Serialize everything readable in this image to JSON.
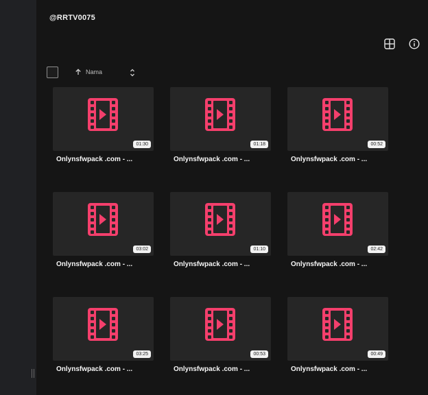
{
  "header": {
    "title": "@RRTV0075"
  },
  "toolbar": {
    "sort_label": "Nama"
  },
  "icons": {
    "grid_view": "grid-view-icon",
    "info": "info-icon",
    "sort_up": "arrow-up-icon",
    "sort_toggle": "chevron-up-down-icon",
    "video_file": "video-file-icon",
    "sidebar_handle": "resize-handle-icon"
  },
  "colors": {
    "video_icon": "#f43f6c",
    "background": "#151515",
    "sidebar": "#202124",
    "thumb": "#262626"
  },
  "files": [
    {
      "name": "Onlynsfwpack .com - ...",
      "duration": "01:30"
    },
    {
      "name": "Onlynsfwpack .com - ...",
      "duration": "01:18"
    },
    {
      "name": "Onlynsfwpack .com - ...",
      "duration": "00:52"
    },
    {
      "name": "Onlynsfwpack .com - ...",
      "duration": "03:02"
    },
    {
      "name": "Onlynsfwpack .com - ...",
      "duration": "01:10"
    },
    {
      "name": "Onlynsfwpack .com - ...",
      "duration": "02:42"
    },
    {
      "name": "Onlynsfwpack .com - ...",
      "duration": "03:25"
    },
    {
      "name": "Onlynsfwpack .com - ...",
      "duration": "00:53"
    },
    {
      "name": "Onlynsfwpack .com - ...",
      "duration": "00:49"
    }
  ]
}
